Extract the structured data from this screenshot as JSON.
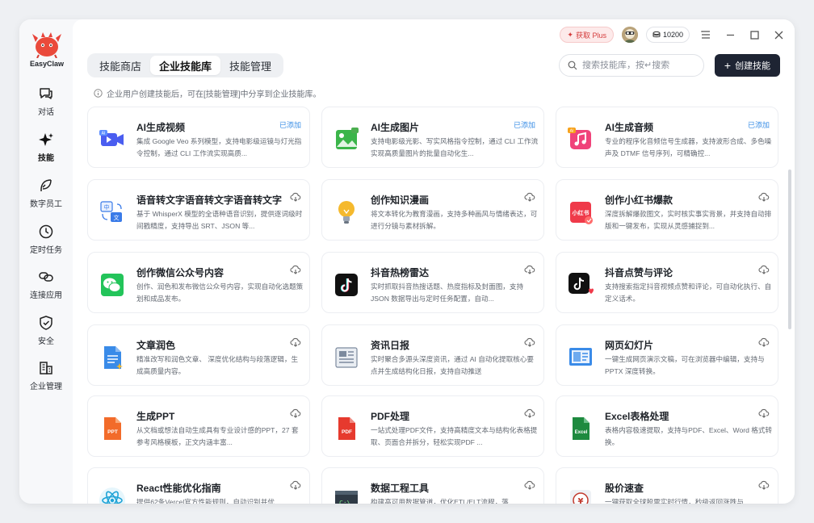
{
  "app": {
    "name": "EasyClaw"
  },
  "sidebar": {
    "items": [
      {
        "label": "对话",
        "icon": "chat-icon"
      },
      {
        "label": "技能",
        "icon": "sparkle-icon"
      },
      {
        "label": "数字员工",
        "icon": "feather-icon"
      },
      {
        "label": "定时任务",
        "icon": "clock-icon"
      },
      {
        "label": "连接应用",
        "icon": "link-icon"
      },
      {
        "label": "安全",
        "icon": "shield-icon"
      },
      {
        "label": "企业管理",
        "icon": "building-icon"
      }
    ],
    "active_index": 1
  },
  "topbar": {
    "plus_label": "获取 Plus",
    "coins": "10200"
  },
  "tabs": [
    "技能商店",
    "企业技能库",
    "技能管理"
  ],
  "active_tab": 1,
  "search": {
    "placeholder": "搜索技能库，按↵搜索"
  },
  "create_button": "创建技能",
  "notice": "企业用户创建技能后，可在[技能管理]中分享到企业技能库。",
  "status_added": "已添加",
  "skills": [
    {
      "title": "AI生成视频",
      "desc": "集成 Google Veo 系列模型，支持电影级运镜与灯光指令控制，通过 CLI 工作流实现高质...",
      "added": true,
      "icon": "video-camera-icon",
      "color": "#4a5df0"
    },
    {
      "title": "AI生成图片",
      "desc": "支持电影级光影、写实风格指令控制，通过 CLI 工作流实现高质量图片的批量自动化生...",
      "added": true,
      "icon": "image-icon",
      "color": "#3bb54a"
    },
    {
      "title": "AI生成音频",
      "desc": "专业的程序化音频信号生成器，支持波形合成、多色噪声及 DTMF 信号序列，可精确控...",
      "added": true,
      "icon": "music-note-icon",
      "color": "#f0437a"
    },
    {
      "title": "语音转文字语音转文字语音转文字",
      "desc": "基于 WhisperX 模型的全语种语音识别，提供逐词级时间戳精度，支持导出 SRT、JSON 等...",
      "added": false,
      "icon": "translate-icon",
      "color": "#3a7be8"
    },
    {
      "title": "创作知识漫画",
      "desc": "将文本转化为教育漫画，支持多种画风与情绪表达，可进行分镜与素材拆解。",
      "added": false,
      "icon": "lightbulb-icon",
      "color": "#f5b92d"
    },
    {
      "title": "创作小红书爆款",
      "desc": "深度拆解爆款图文，实时核实事实背景，并支持自动排版和一键发布，实现从灵感捕捉到...",
      "added": false,
      "icon": "xiaohongshu-icon",
      "color": "#ef3a4a"
    },
    {
      "title": "创作微信公众号内容",
      "desc": "创作、润色和发布微信公众号内容，实现自动化选题策划和成品发布。",
      "added": false,
      "icon": "wechat-icon",
      "color": "#23c45a"
    },
    {
      "title": "抖音热榜雷达",
      "desc": "实时抓取抖音热搜话题、热度指标及封面图，支持 JSON 数据导出与定时任务配置，自动...",
      "added": false,
      "icon": "douyin-icon",
      "color": "#111111"
    },
    {
      "title": "抖音点赞与评论",
      "desc": "支持搜索指定抖音视频点赞和评论，可自动化执行、自定义话术。",
      "added": false,
      "icon": "douyin-like-icon",
      "color": "#111111"
    },
    {
      "title": "文章润色",
      "desc": "精准改写和润色文章、 深度优化结构与段落逻辑，生成高质量内容。",
      "added": false,
      "icon": "document-icon",
      "color": "#3a8be8"
    },
    {
      "title": "资讯日报",
      "desc": "实时聚合多源头深度资讯，通过 AI 自动化提取核心要点并生成结构化日报，支持自动推送",
      "added": false,
      "icon": "newspaper-icon",
      "color": "#7c8a9e"
    },
    {
      "title": "网页幻灯片",
      "desc": "一键生成网页演示文稿，可在浏览器中编辑，支持与 PPTX 深度转换。",
      "added": false,
      "icon": "slides-icon",
      "color": "#3a8be8"
    },
    {
      "title": "生成PPT",
      "desc": "从文档或想法自动生成具有专业设计感的PPT，27 套参考风格模板，正文内涵丰富...",
      "added": false,
      "icon": "ppt-file-icon",
      "color": "#f26b2a"
    },
    {
      "title": "PDF处理",
      "desc": "一站式处理PDF文件，支持高精度文本与结构化表格提取、页面合并拆分，轻松实现PDF ...",
      "added": false,
      "icon": "pdf-file-icon",
      "color": "#e63a2e"
    },
    {
      "title": "Excel表格处理",
      "desc": "表格内容极速提取，支持与PDF、Excel、Word 格式转换。",
      "added": false,
      "icon": "excel-file-icon",
      "color": "#1e8a3f"
    },
    {
      "title": "React性能优化指南",
      "desc": "提供62条Vercel官方性能规则，自动识别并优",
      "added": false,
      "icon": "react-icon",
      "color": "#1fa3d6"
    },
    {
      "title": "数据工程工具",
      "desc": "构建高可用数据管道，优化ETL/ELT流程，落",
      "added": false,
      "icon": "terminal-icon",
      "color": "#2f3a45"
    },
    {
      "title": "股价速查",
      "desc": "一键获取全球股票实时行情，秒级返回涨跌与",
      "added": false,
      "icon": "stock-icon",
      "color": "#c23a2e"
    }
  ]
}
